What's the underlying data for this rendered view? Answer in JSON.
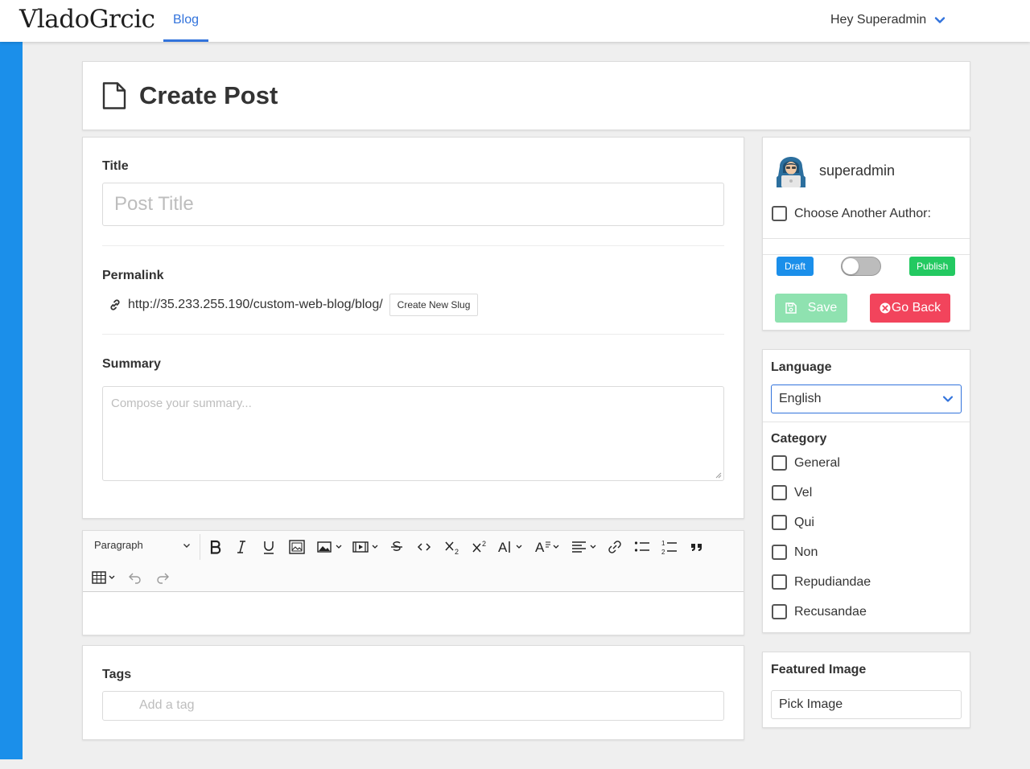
{
  "navbar": {
    "logo": "VladoGrcic",
    "nav_blog": "Blog",
    "user_greeting": "Hey Superadmin"
  },
  "page": {
    "title": "Create Post"
  },
  "form": {
    "title_label": "Title",
    "title_placeholder": "Post Title",
    "permalink_label": "Permalink",
    "permalink_url": "http://35.233.255.190/custom-web-blog/blog/",
    "create_slug_button": "Create New Slug",
    "summary_label": "Summary",
    "summary_placeholder": "Compose your summary..."
  },
  "editor": {
    "paragraph_select": "Paragraph",
    "tools": [
      "bold-icon",
      "italic-icon",
      "underline-icon",
      "image-insert-icon",
      "image-dropdown-icon",
      "media-icon",
      "strikethrough-icon",
      "code-icon",
      "subscript-icon",
      "superscript-icon",
      "font-size-icon",
      "font-style-icon",
      "align-icon",
      "link-icon",
      "bulleted-list-icon",
      "numbered-list-icon",
      "quote-icon",
      "table-icon",
      "undo-icon",
      "redo-icon"
    ]
  },
  "tags": {
    "label": "Tags",
    "placeholder": "Add a tag"
  },
  "publish": {
    "author_name": "superadmin",
    "choose_author_label": "Choose Another Author:",
    "draft_label": "Draft",
    "publish_label": "Publish",
    "publish_toggle_on": false,
    "save_button": "Save",
    "go_back_button": "Go Back"
  },
  "language": {
    "label": "Language",
    "selected": "English"
  },
  "category": {
    "label": "Category",
    "items": [
      {
        "label": "General"
      },
      {
        "label": "Vel"
      },
      {
        "label": "Qui"
      },
      {
        "label": "Non"
      },
      {
        "label": "Repudiandae"
      },
      {
        "label": "Recusandae"
      }
    ]
  },
  "featured_image": {
    "label": "Featured Image",
    "button": "Pick Image"
  },
  "colors": {
    "accent_blue": "#3273dc",
    "sidebar_blue": "#1b8fea",
    "draft_blue": "#1b8fea",
    "publish_green": "#23c961",
    "save_green": "#8fe2b0",
    "danger_red": "#f2445c"
  }
}
